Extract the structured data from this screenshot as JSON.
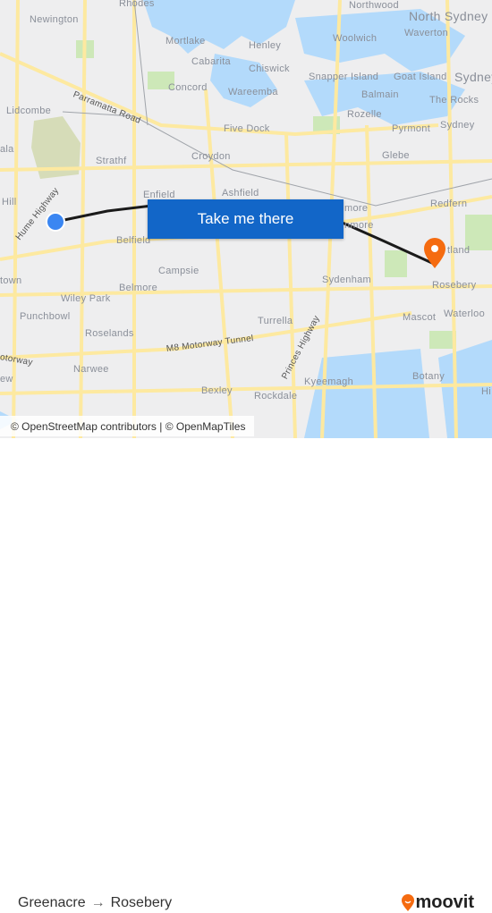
{
  "map": {
    "labels": {
      "rhodes": "Rhodes",
      "northwood": "Northwood",
      "north_sydney": "North Sydney",
      "newington": "Newington",
      "mortlake": "Mortlake",
      "henley": "Henley",
      "woolwich": "Woolwich",
      "waverton": "Waverton",
      "cabarita": "Cabarita",
      "chiswick": "Chiswick",
      "snapper_island": "Snapper Island",
      "goat_island": "Goat Island",
      "sydney_n": "Sydney",
      "concord": "Concord",
      "wareemba": "Wareemba",
      "balmain": "Balmain",
      "the_rocks": "The Rocks",
      "lidcombe": "Lidcombe",
      "five_dock": "Five Dock",
      "rozelle": "Rozelle",
      "pyrmont": "Pyrmont",
      "sydney": "Sydney",
      "ala": "ala",
      "strathf": "Strathf",
      "croydon": "Croydon",
      "glebe": "Glebe",
      "hill": "Hill",
      "enfield": "Enfield",
      "ashfield": "Ashfield",
      "redfern": "Redfern",
      "more": "more",
      "nmore": "nmore",
      "belfield": "Belfield",
      "zetland": "tland",
      "campsie": "Campsie",
      "town": "town",
      "sydenham": "Sydenham",
      "rosebery": "Rosebery",
      "wiley_park": "Wiley Park",
      "belmore": "Belmore",
      "punchbowl": "Punchbowl",
      "mascot": "Mascot",
      "turrella": "Turrella",
      "roselands": "Roselands",
      "waterloo": "Waterloo",
      "narwee": "Narwee",
      "bexley": "Bexley",
      "rockdale": "Rockdale",
      "kyeemagh": "Kyeemagh",
      "botany": "Botany",
      "hi": "Hi",
      "ew": "ew"
    },
    "roads": {
      "parramatta_road": "Parramatta Road",
      "hume_highway": "Hume Highway",
      "m8": "M8 Motorway Tunnel",
      "princes_highway": "Princes Highway",
      "motorway": "otorway"
    },
    "cta_label": "Take me there",
    "attribution": "© OpenStreetMap contributors | © OpenMapTiles",
    "colors": {
      "water": "#b3dafb",
      "park": "#cde8b8",
      "road": "#fde9a0",
      "route": "#1a1a1a",
      "origin": "#3a86f2",
      "destination": "#f56b10",
      "cta": "#1266c8"
    }
  },
  "footer": {
    "origin": "Greenacre",
    "destination": "Rosebery",
    "arrow": "→",
    "brand": "moovit"
  }
}
